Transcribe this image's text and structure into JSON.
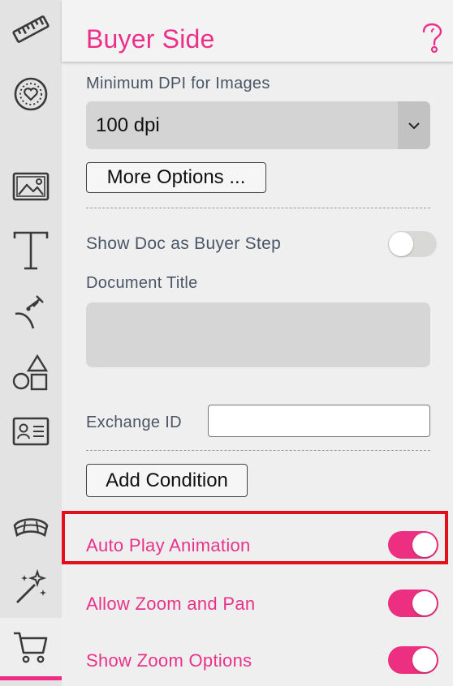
{
  "sidebar": {
    "tools": [
      "ruler-icon",
      "badge-heart-icon",
      "image-icon",
      "text-icon",
      "signature-icon",
      "shapes-icon",
      "id-card-icon",
      "dome-icon",
      "magic-wand-icon",
      "cart-icon"
    ],
    "active_tool": "cart-icon",
    "accent_color": "#ef2a87"
  },
  "panel": {
    "title": "Buyer Side",
    "help_icon": "question-mark-icon",
    "min_dpi_label": "Minimum DPI for Images",
    "min_dpi_value": "100 dpi",
    "more_options_label": "More Options ...",
    "show_doc_label": "Show Doc as Buyer Step",
    "show_doc_on": false,
    "document_title_label": "Document Title",
    "document_title_value": "",
    "exchange_id_label": "Exchange ID",
    "exchange_id_value": "",
    "add_condition_label": "Add Condition",
    "auto_play_label": "Auto Play Animation",
    "auto_play_on": true,
    "allow_zoom_label": "Allow Zoom and Pan",
    "allow_zoom_on": true,
    "show_zoom_label": "Show Zoom Options",
    "show_zoom_on": true
  },
  "colors": {
    "accent": "#ec2f8b",
    "highlight_box": "#e0101c"
  }
}
